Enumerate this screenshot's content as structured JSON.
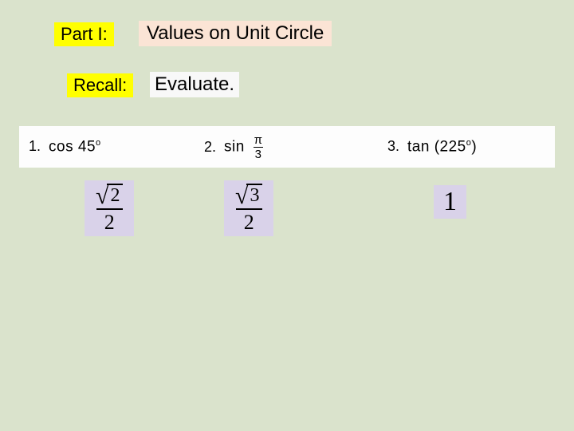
{
  "header": {
    "part_label": "Part I:",
    "title": "Values on Unit Circle",
    "recall_label": "Recall:",
    "instruction": "Evaluate."
  },
  "problems": {
    "p1": {
      "num": "1.",
      "func": "cos",
      "arg_prefix": "45",
      "arg_suffix": "o"
    },
    "p2": {
      "num": "2.",
      "func": "sin",
      "frac_top": "π",
      "frac_bot": "3"
    },
    "p3": {
      "num": "3.",
      "func": "tan",
      "arg_prefix": "(225",
      "arg_suffix": "o",
      "arg_close": ")"
    }
  },
  "answers": {
    "a1": {
      "sqrt_radicand": "2",
      "denom": "2"
    },
    "a2": {
      "sqrt_radicand": "3",
      "denom": "2"
    },
    "a3": {
      "value": "1"
    }
  }
}
